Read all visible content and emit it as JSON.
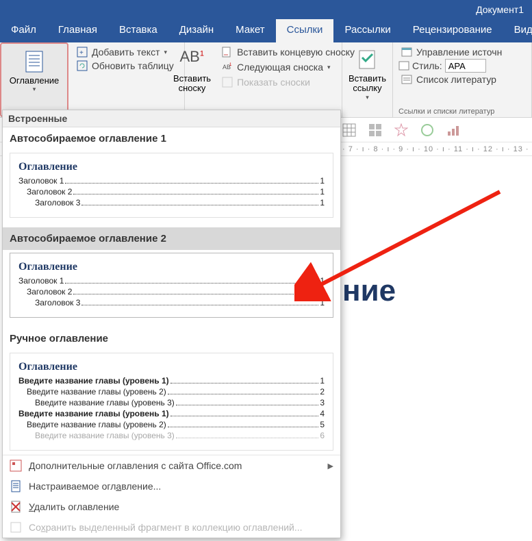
{
  "title_bar": {
    "document_name": "Документ1"
  },
  "tabs": {
    "file": "Файл",
    "home": "Главная",
    "insert": "Вставка",
    "design": "Дизайн",
    "layout": "Макет",
    "references": "Ссылки",
    "mailings": "Рассылки",
    "review": "Рецензирование",
    "view": "Вид"
  },
  "ribbon": {
    "toc_button": "Оглавление",
    "add_text": "Добавить текст",
    "update_table": "Обновить таблицу",
    "insert_footnote_big": "Вставить сноску",
    "ab_label": "АВ",
    "insert_endnote": "Вставить концевую сноску",
    "next_footnote": "Следующая сноска",
    "show_footnotes": "Показать сноски",
    "insert_link_big": "Вставить ссылку",
    "manage_sources": "Управление источн",
    "style_label": "Стиль:",
    "style_value": "APA",
    "bibliography": "Список литератур",
    "group_label_links": "Ссылки и списки литератур"
  },
  "ruler_text": "· 7 · ı · 8 · ı · 9 · ı · 10 · ı · 11 · ı · 12 · ı · 13 ·",
  "document": {
    "heading": "ние"
  },
  "dropdown": {
    "builtin_header": "Встроенные",
    "auto1_title": "Автособираемое оглавление 1",
    "auto2_title": "Автособираемое оглавление 2",
    "manual_title": "Ручное оглавление",
    "preview": {
      "title": "Оглавление",
      "h1": "Заголовок 1",
      "h2": "Заголовок 2",
      "h3": "Заголовок 3",
      "pg": "1"
    },
    "manual_preview": {
      "l1": "Введите название главы (уровень 1)",
      "l2": "Введите название главы (уровень 2)",
      "l3": "Введите название главы (уровень 3)",
      "p1": "1",
      "p2": "2",
      "p3": "3",
      "p4": "4",
      "p5": "5",
      "p6": "6"
    },
    "more_office": "Дополнительные оглавления с сайта Office.com",
    "custom_toc": "Настраиваемое оглавление...",
    "remove_toc": "Удалить оглавление",
    "save_selection": "Сохранить выделенный фрагмент в коллекцию оглавлений..."
  }
}
